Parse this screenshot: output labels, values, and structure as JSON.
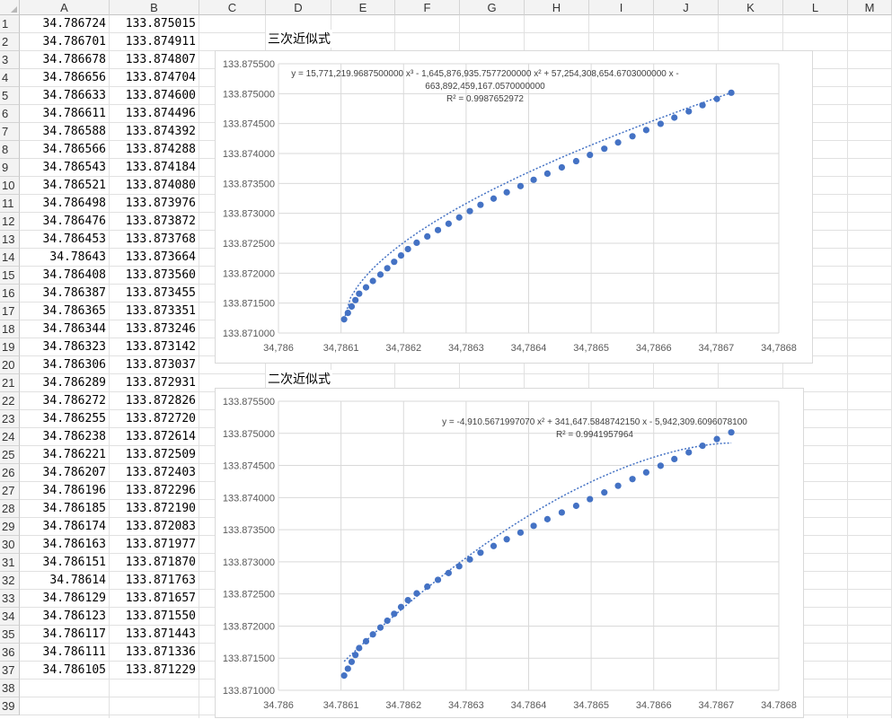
{
  "spreadsheet": {
    "columns": [
      "A",
      "B",
      "C",
      "D",
      "E",
      "F",
      "G",
      "H",
      "I",
      "J",
      "K",
      "L",
      "M"
    ],
    "rows": [
      [
        "34.786724",
        "133.875015"
      ],
      [
        "34.786701",
        "133.874911"
      ],
      [
        "34.786678",
        "133.874807"
      ],
      [
        "34.786656",
        "133.874704"
      ],
      [
        "34.786633",
        "133.874600"
      ],
      [
        "34.786611",
        "133.874496"
      ],
      [
        "34.786588",
        "133.874392"
      ],
      [
        "34.786566",
        "133.874288"
      ],
      [
        "34.786543",
        "133.874184"
      ],
      [
        "34.786521",
        "133.874080"
      ],
      [
        "34.786498",
        "133.873976"
      ],
      [
        "34.786476",
        "133.873872"
      ],
      [
        "34.786453",
        "133.873768"
      ],
      [
        "34.78643",
        "133.873664"
      ],
      [
        "34.786408",
        "133.873560"
      ],
      [
        "34.786387",
        "133.873455"
      ],
      [
        "34.786365",
        "133.873351"
      ],
      [
        "34.786344",
        "133.873246"
      ],
      [
        "34.786323",
        "133.873142"
      ],
      [
        "34.786306",
        "133.873037"
      ],
      [
        "34.786289",
        "133.872931"
      ],
      [
        "34.786272",
        "133.872826"
      ],
      [
        "34.786255",
        "133.872720"
      ],
      [
        "34.786238",
        "133.872614"
      ],
      [
        "34.786221",
        "133.872509"
      ],
      [
        "34.786207",
        "133.872403"
      ],
      [
        "34.786196",
        "133.872296"
      ],
      [
        "34.786185",
        "133.872190"
      ],
      [
        "34.786174",
        "133.872083"
      ],
      [
        "34.786163",
        "133.871977"
      ],
      [
        "34.786151",
        "133.871870"
      ],
      [
        "34.78614",
        "133.871763"
      ],
      [
        "34.786129",
        "133.871657"
      ],
      [
        "34.786123",
        "133.871550"
      ],
      [
        "34.786117",
        "133.871443"
      ],
      [
        "34.786111",
        "133.871336"
      ],
      [
        "34.786105",
        "133.871229"
      ],
      [
        "",
        ""
      ],
      [
        "",
        ""
      ]
    ]
  },
  "labels": {
    "cubic": "三次近似式",
    "quadratic": "二次近似式"
  },
  "chart_data": [
    {
      "type": "scatter",
      "trendline": "polynomial-3",
      "equation_line1": "y = 15,771,219.9687500000 x³ - 1,645,876,935.7577200000 x² + 57,254,308,654.6703000000 x -",
      "equation_line2": "663,892,459,167.0570000000",
      "r2": "R² = 0.9987652972",
      "xlim": [
        34.786,
        34.7868
      ],
      "ylim": [
        133.871,
        133.8755
      ],
      "x_ticks": [
        "34,786",
        "34,7861",
        "34,7862",
        "34,7863",
        "34,7864",
        "34,7865",
        "34,7866",
        "34,7867",
        "34,7868"
      ],
      "y_ticks": [
        "133.871000",
        "133.871500",
        "133.872000",
        "133.872500",
        "133.873000",
        "133.873500",
        "133.874000",
        "133.874500",
        "133.875000",
        "133.875500"
      ],
      "grid": true,
      "marker_color": "#4472c4"
    },
    {
      "type": "scatter",
      "trendline": "polynomial-2",
      "equation_line1": "y = -4,910.5671997070 x² + 341,647.5848742150 x - 5,942,309.6096078100",
      "equation_line2": "",
      "r2": "R² = 0.9941957964",
      "xlim": [
        34.786,
        34.7868
      ],
      "ylim": [
        133.871,
        133.8755
      ],
      "x_ticks": [
        "34.786",
        "34.7861",
        "34.7862",
        "34.7863",
        "34.7864",
        "34.7865",
        "34.7866",
        "34.7867",
        "34.7868"
      ],
      "y_ticks": [
        "133.871000",
        "133.871500",
        "133.872000",
        "133.872500",
        "133.873000",
        "133.873500",
        "133.874000",
        "133.874500",
        "133.875000",
        "133.875500"
      ],
      "grid": true,
      "marker_color": "#4472c4"
    }
  ]
}
